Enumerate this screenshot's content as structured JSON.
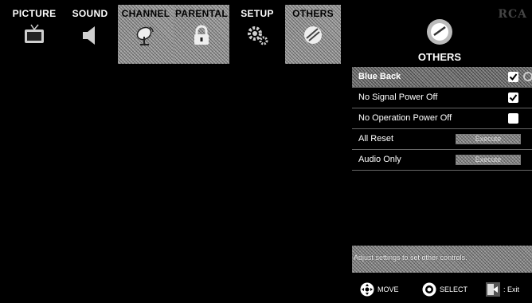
{
  "brand": "RCA",
  "tabs": [
    {
      "label": "PICTURE",
      "icon": "tv-icon"
    },
    {
      "label": "SOUND",
      "icon": "speaker-icon"
    },
    {
      "label": "CHANNEL",
      "icon": "satellite-dish-icon"
    },
    {
      "label": "PARENTAL",
      "icon": "padlock-icon"
    },
    {
      "label": "SETUP",
      "icon": "gears-icon"
    },
    {
      "label": "OTHERS",
      "icon": "others-disc-icon"
    }
  ],
  "active_section": {
    "title": "OTHERS",
    "icon": "others-disc-icon"
  },
  "settings": [
    {
      "label": "Blue Back",
      "control": "checkbox",
      "checked": true
    },
    {
      "label": "No Signal Power Off",
      "control": "checkbox",
      "checked": true
    },
    {
      "label": "No Operation Power Off",
      "control": "checkbox",
      "checked": false
    },
    {
      "label": "All Reset",
      "control": "button",
      "button_label": "Execute"
    },
    {
      "label": "Audio Only",
      "control": "button",
      "button_label": "Execute"
    }
  ],
  "help": {
    "text": "Adjust settings to set other controls."
  },
  "footer": {
    "move": "MOVE",
    "select": "SELECT",
    "exit": ": Exit"
  }
}
